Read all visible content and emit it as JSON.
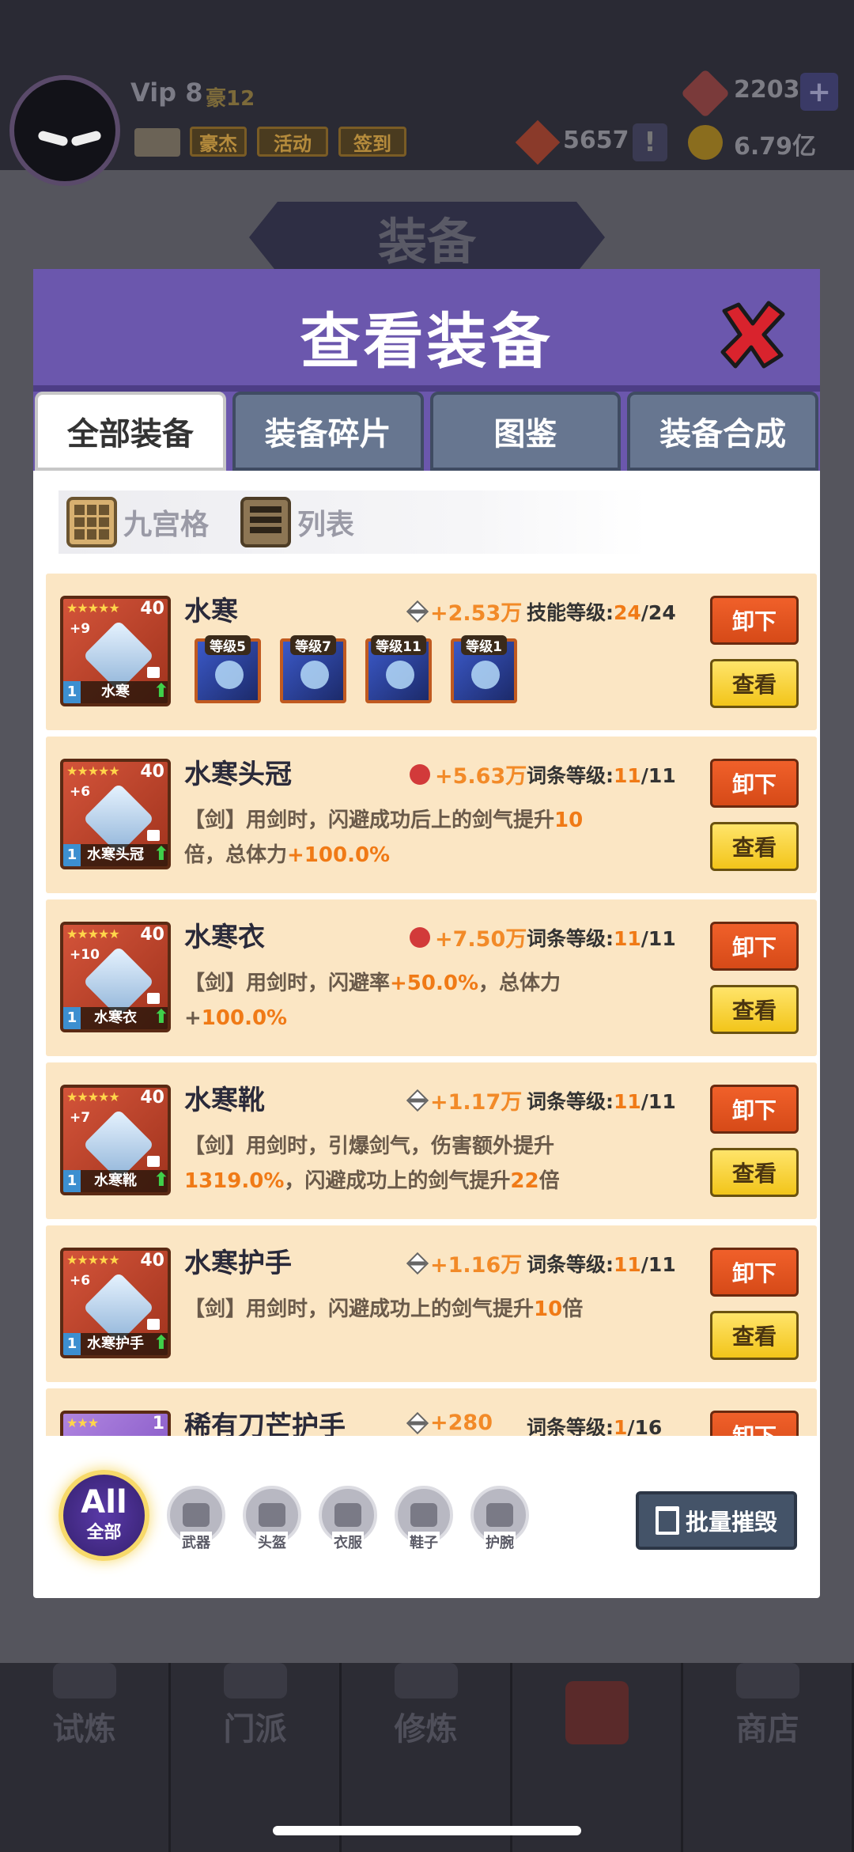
{
  "header": {
    "vip": "Vip 8",
    "vip_sub": "豪12",
    "buttons": [
      "豪杰",
      "活动",
      "签到"
    ],
    "gems": "2203",
    "tokens": "5657",
    "gold": "6.79亿",
    "bg_title": "装备"
  },
  "modal": {
    "title": "查看装备",
    "tabs": [
      "全部装备",
      "装备碎片",
      "图鉴",
      "装备合成"
    ],
    "views": [
      "九宫格",
      "列表"
    ]
  },
  "items": [
    {
      "name": "水寒",
      "thumb_name": "水寒",
      "stars": "★★★★★",
      "level": "40",
      "plus": "+9",
      "num": "1",
      "stat_icon": "sword-icon",
      "stat": "+2.53万",
      "level_label": "技能等级:",
      "level_cur": "24",
      "level_max": "/24",
      "skills": [
        "等级5",
        "等级7",
        "等级11",
        "等级1"
      ]
    },
    {
      "name": "水寒头冠",
      "thumb_name": "水寒头冠",
      "stars": "★★★★★",
      "level": "40",
      "plus": "+6",
      "num": "1",
      "stat_icon": "heart-icon",
      "stat": "+5.63万",
      "level_label": "词条等级:",
      "level_cur": "11",
      "level_max": "/11",
      "desc": [
        {
          "t": "【剑】用剑时，闪避成功后上的剑气提升"
        },
        {
          "t": "10",
          "hi": true
        },
        {
          "t": "倍，总体力"
        },
        {
          "t": "+100.0%",
          "hi": true
        }
      ]
    },
    {
      "name": "水寒衣",
      "thumb_name": "水寒衣",
      "stars": "★★★★★",
      "level": "40",
      "plus": "+10",
      "num": "1",
      "stat_icon": "heart-icon",
      "stat": "+7.50万",
      "level_label": "词条等级:",
      "level_cur": "11",
      "level_max": "/11",
      "desc": [
        {
          "t": "【剑】用剑时，闪避率"
        },
        {
          "t": "+50.0%",
          "hi": true
        },
        {
          "t": "，总体力+"
        },
        {
          "t": "100.0%",
          "hi": true
        }
      ]
    },
    {
      "name": "水寒靴",
      "thumb_name": "水寒靴",
      "stars": "★★★★★",
      "level": "40",
      "plus": "+7",
      "num": "1",
      "stat_icon": "sword-icon",
      "stat": "+1.17万",
      "level_label": "词条等级:",
      "level_cur": "11",
      "level_max": "/11",
      "desc": [
        {
          "t": "【剑】用剑时，引爆剑气，伤害额外提升"
        },
        {
          "t": "1319.0%",
          "hi": true
        },
        {
          "t": "，闪避成功上的剑气提升"
        },
        {
          "t": "22",
          "hi": true
        },
        {
          "t": "倍"
        }
      ]
    },
    {
      "name": "水寒护手",
      "thumb_name": "水寒护手",
      "stars": "★★★★★",
      "level": "40",
      "plus": "+6",
      "num": "1",
      "stat_icon": "sword-icon",
      "stat": "+1.16万",
      "level_label": "词条等级:",
      "level_cur": "11",
      "level_max": "/11",
      "desc": [
        {
          "t": "【剑】用剑时，闪避成功上的剑气提升"
        },
        {
          "t": "10",
          "hi": true
        },
        {
          "t": "倍"
        }
      ]
    },
    {
      "name": "稀有刀芒护手",
      "thumb_name": "",
      "stars": "★★★",
      "level": "1",
      "plus": "",
      "num": "",
      "stat_icon": "sword-icon",
      "stat": "+280",
      "level_label": "词条等级:",
      "level_cur": "1",
      "level_max": "/16",
      "purple": true
    }
  ],
  "buttons": {
    "unequip": "卸下",
    "view": "查看",
    "bulk_destroy": "批量摧毁"
  },
  "filters": {
    "all_top": "All",
    "all_bottom": "全部",
    "types": [
      "武器",
      "头盔",
      "衣服",
      "鞋子",
      "护腕"
    ]
  },
  "bottom_nav": [
    "试炼",
    "门派",
    "修炼",
    "",
    "商店"
  ]
}
